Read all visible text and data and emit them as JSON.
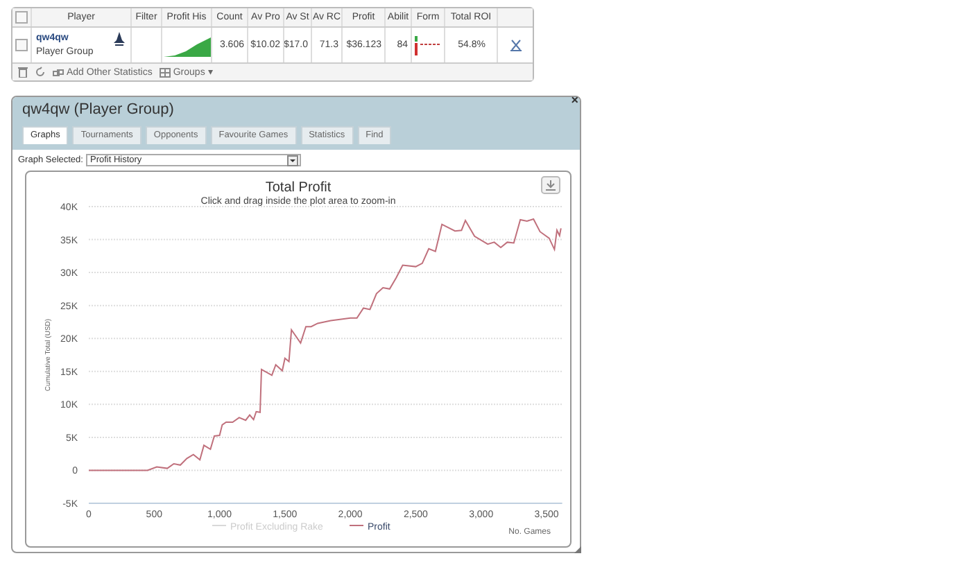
{
  "stats_table": {
    "header_checked": false,
    "columns": [
      "Player",
      "Filter",
      "Profit His",
      "Count",
      "Av Pro",
      "Av St",
      "Av RC",
      "Profit",
      "Abilit",
      "Form",
      "Total ROI"
    ],
    "rows": [
      {
        "checked": false,
        "player": "qw4qw",
        "group": "Player Group",
        "filter": "",
        "count": "3.606",
        "av_profit": "$10.02",
        "av_stake": "$17.0",
        "av_roi": "71.3",
        "profit": "$36.123",
        "ability": "84",
        "total_roi": "54.8%"
      }
    ],
    "footer": {
      "add_label": "Add Other Statistics",
      "groups_label": "Groups ▾"
    }
  },
  "panel": {
    "title": "qw4qw (Player Group)",
    "close": "×",
    "tabs": [
      {
        "label": "Graphs",
        "selected": true
      },
      {
        "label": "Tournaments",
        "selected": false
      },
      {
        "label": "Opponents",
        "selected": false
      },
      {
        "label": "Favourite Games",
        "selected": false
      },
      {
        "label": "Statistics",
        "selected": false
      },
      {
        "label": "Find",
        "selected": false
      }
    ],
    "graph_select": {
      "label": "Graph Selected:",
      "value": "Profit History"
    },
    "legend": [
      {
        "visible": false
      },
      {
        "visible": true
      }
    ],
    "chart_data": {
      "type": "line",
      "title": "Total Profit",
      "subtitle": "Click and drag inside the plot area to zoom-in",
      "xlabel": "No. Games",
      "ylabel": "Cumulative Total (USD)",
      "x": [
        0,
        450,
        520,
        600,
        650,
        700,
        750,
        800,
        850,
        880,
        930,
        960,
        1000,
        1020,
        1050,
        1100,
        1150,
        1200,
        1230,
        1260,
        1280,
        1310,
        1320,
        1400,
        1430,
        1480,
        1500,
        1530,
        1550,
        1620,
        1660,
        1700,
        1750,
        1850,
        2000,
        2050,
        2100,
        2150,
        2200,
        2250,
        2300,
        2350,
        2400,
        2500,
        2550,
        2600,
        2650,
        2700,
        2800,
        2850,
        2880,
        2950,
        3050,
        3100,
        3150,
        3200,
        3250,
        3300,
        3350,
        3400,
        3450,
        3520,
        3560,
        3580,
        3600,
        3610
      ],
      "grid": true,
      "series": [
        {
          "name": "Profit Excluding Rake",
          "color": "#d8d8d8",
          "values": [
            null,
            null,
            null,
            null,
            null,
            null,
            null,
            null,
            null,
            null,
            null,
            null,
            null,
            null,
            null,
            null,
            null,
            null,
            null,
            null,
            null,
            null,
            null,
            null,
            null,
            null,
            null,
            null,
            null,
            null,
            null,
            null,
            null,
            null,
            null,
            null,
            null,
            null,
            null,
            null,
            null,
            null,
            null,
            null,
            null,
            null,
            null,
            null,
            null,
            null,
            null,
            null,
            null,
            null,
            null,
            null,
            null,
            null,
            null,
            null,
            null,
            null,
            null,
            null,
            null,
            null
          ]
        },
        {
          "name": "Profit",
          "color": "#c0707c",
          "values": [
            0,
            0,
            500,
            300,
            1000,
            800,
            1800,
            2400,
            1600,
            3800,
            3200,
            5200,
            5300,
            6900,
            7300,
            7300,
            8000,
            7600,
            8400,
            7700,
            8900,
            8800,
            15300,
            14400,
            16000,
            15100,
            17000,
            16500,
            21300,
            19300,
            21800,
            21800,
            22300,
            22700,
            23100,
            23100,
            24600,
            24400,
            26800,
            27700,
            27500,
            29200,
            31100,
            30900,
            31400,
            33600,
            33200,
            37300,
            36300,
            36400,
            37900,
            35500,
            34300,
            34600,
            33800,
            34600,
            34500,
            38000,
            37800,
            38100,
            36200,
            35200,
            33500,
            36400,
            35600,
            36700
          ]
        }
      ],
      "xlim": [
        0,
        3620
      ],
      "ylim": [
        -5000,
        40000
      ],
      "xticks": [
        {
          "value": 0,
          "label": "0"
        },
        {
          "value": 500,
          "label": "500"
        },
        {
          "value": 1000,
          "label": "1,000"
        },
        {
          "value": 1500,
          "label": "1,500"
        },
        {
          "value": 2000,
          "label": "2,000"
        },
        {
          "value": 2500,
          "label": "2,500"
        },
        {
          "value": 3000,
          "label": "3,000"
        },
        {
          "value": 3500,
          "label": "3,500"
        }
      ],
      "yticks": [
        {
          "value": -5000,
          "label": "-5K"
        },
        {
          "value": 0,
          "label": "0"
        },
        {
          "value": 5000,
          "label": "5K"
        },
        {
          "value": 10000,
          "label": "10K"
        },
        {
          "value": 15000,
          "label": "15K"
        },
        {
          "value": 20000,
          "label": "20K"
        },
        {
          "value": 25000,
          "label": "25K"
        },
        {
          "value": 30000,
          "label": "30K"
        },
        {
          "value": 35000,
          "label": "35K"
        },
        {
          "value": 40000,
          "label": "40K"
        }
      ]
    }
  }
}
